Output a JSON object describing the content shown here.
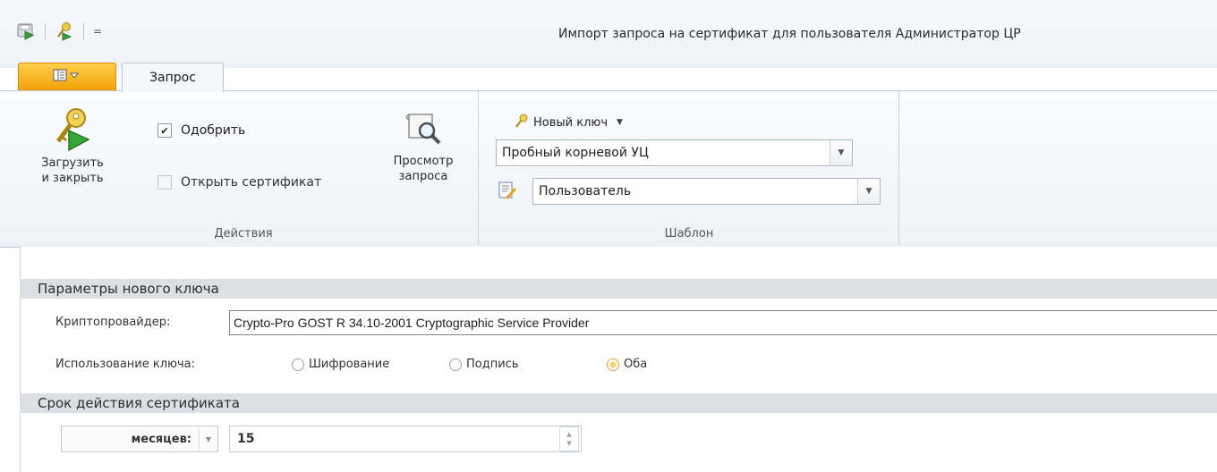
{
  "window": {
    "title": "Импорт запроса на сертификат для пользователя Администратор ЦР"
  },
  "quick_access": {
    "icons": [
      "save-load-icon",
      "key-icon"
    ],
    "customize_glyph": "="
  },
  "tabs": {
    "app_menu_icon": "app-menu-icon",
    "active": "Запрос"
  },
  "ribbon": {
    "actions": {
      "group_label": "Действия",
      "load_close_line1": "Загрузить",
      "load_close_line2": "и закрыть",
      "approve_label": "Одобрить",
      "approve_checked": true,
      "open_cert_label": "Открыть сертификат",
      "open_cert_checked": false,
      "view_request_line1": "Просмотр",
      "view_request_line2": "запроса"
    },
    "template": {
      "group_label": "Шаблон",
      "new_key_label": "Новый ключ",
      "ca_value": "Пробный корневой УЦ",
      "user_value": "Пользователь"
    }
  },
  "key_params": {
    "section_title": "Параметры нового ключа",
    "provider_label": "Криптопровайдер:",
    "provider_value": "Crypto-Pro GOST R 34.10-2001 Cryptographic Service Provider",
    "usage_label": "Использование ключа:",
    "usage_options": [
      "Шифрование",
      "Подпись",
      "Оба"
    ],
    "usage_selected": "Оба"
  },
  "validity": {
    "section_title": "Срок действия сертификата",
    "unit_value": "месяцев:",
    "period_value": "15"
  },
  "colors": {
    "app_menu": "#f2a209",
    "section_header": "#dcdfe4",
    "ribbon_border": "#b9c6d6"
  }
}
